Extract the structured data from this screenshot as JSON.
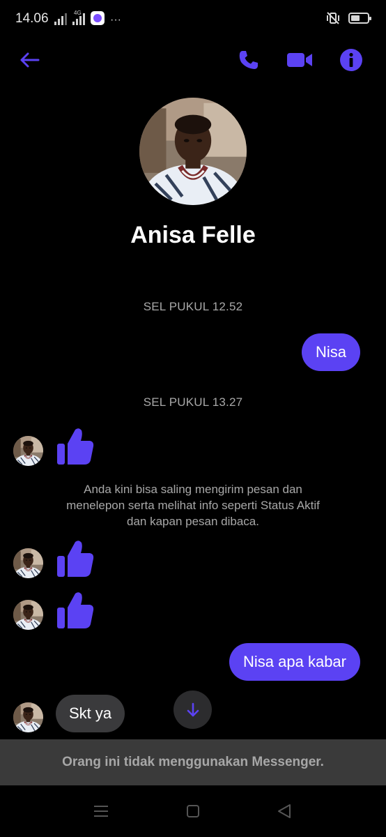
{
  "status_bar": {
    "time": "14.06",
    "network_label": "4G",
    "more": "···"
  },
  "header": {
    "back_icon": "arrow-left-icon",
    "call_icon": "phone-icon",
    "video_icon": "video-camera-icon",
    "info_icon": "info-icon",
    "accent_color": "#5b42f3"
  },
  "profile": {
    "name": "Anisa Felle"
  },
  "conversation": {
    "timestamp_1": "SEL PUKUL 12.52",
    "outgoing_1": "Nisa",
    "timestamp_2": "SEL PUKUL 13.27",
    "system_message": "Anda kini bisa saling mengirim pesan dan menelepon serta melihat info seperti Status Aktif dan kapan pesan dibaca.",
    "outgoing_2": "Nisa apa kabar",
    "incoming_1": "Skt ya"
  },
  "notice": {
    "text": "Orang ini tidak menggunakan Messenger."
  },
  "nav": {
    "menu_icon": "menu-icon",
    "home_icon": "home-square-icon",
    "back_icon": "back-triangle-icon"
  }
}
